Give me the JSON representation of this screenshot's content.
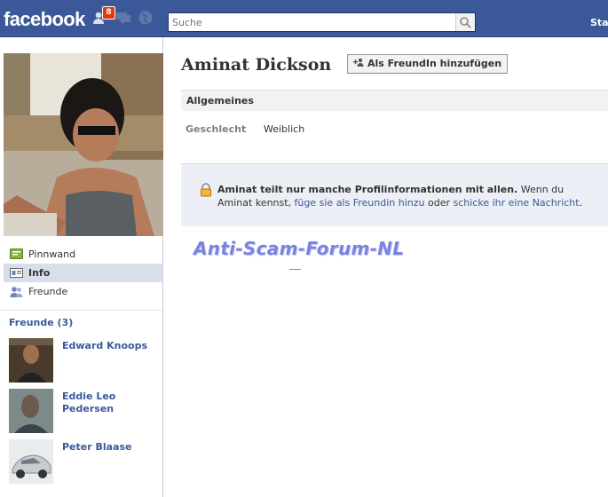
{
  "topbar": {
    "logo": "facebook",
    "notification_count": "8",
    "search_placeholder": "Suche",
    "right_link": "Sta"
  },
  "profile": {
    "name": "Aminat Dickson",
    "add_friend_label": "Als FreundIn hinzufügen"
  },
  "nav": {
    "items": [
      {
        "label": "Pinnwand",
        "icon": "wall-icon"
      },
      {
        "label": "Info",
        "icon": "info-icon",
        "active": true
      },
      {
        "label": "Freunde",
        "icon": "friends-icon"
      }
    ]
  },
  "friends": {
    "header": "Freunde (3)",
    "list": [
      {
        "name": "Edward Knoops"
      },
      {
        "name": "Eddie Leo Pedersen"
      },
      {
        "name": "Peter Blaase"
      }
    ]
  },
  "info": {
    "section_title": "Allgemeines",
    "rows": [
      {
        "label": "Geschlecht",
        "value": "Weiblich"
      }
    ]
  },
  "notice": {
    "bold": "Aminat teilt nur manche Profilinformationen mit allen.",
    "text1": " Wenn du Aminat kennst, ",
    "link1": "füge sie als Freundin hinzu",
    "text2": " oder ",
    "link2": "schicke ihr eine Nachricht",
    "text3": "."
  },
  "watermark": "Anti-Scam-Forum-NL",
  "colors": {
    "brand": "#3b5998",
    "nav_active": "#d8dfea",
    "notice_bg": "#eceff5",
    "badge": "#dd3c10"
  }
}
